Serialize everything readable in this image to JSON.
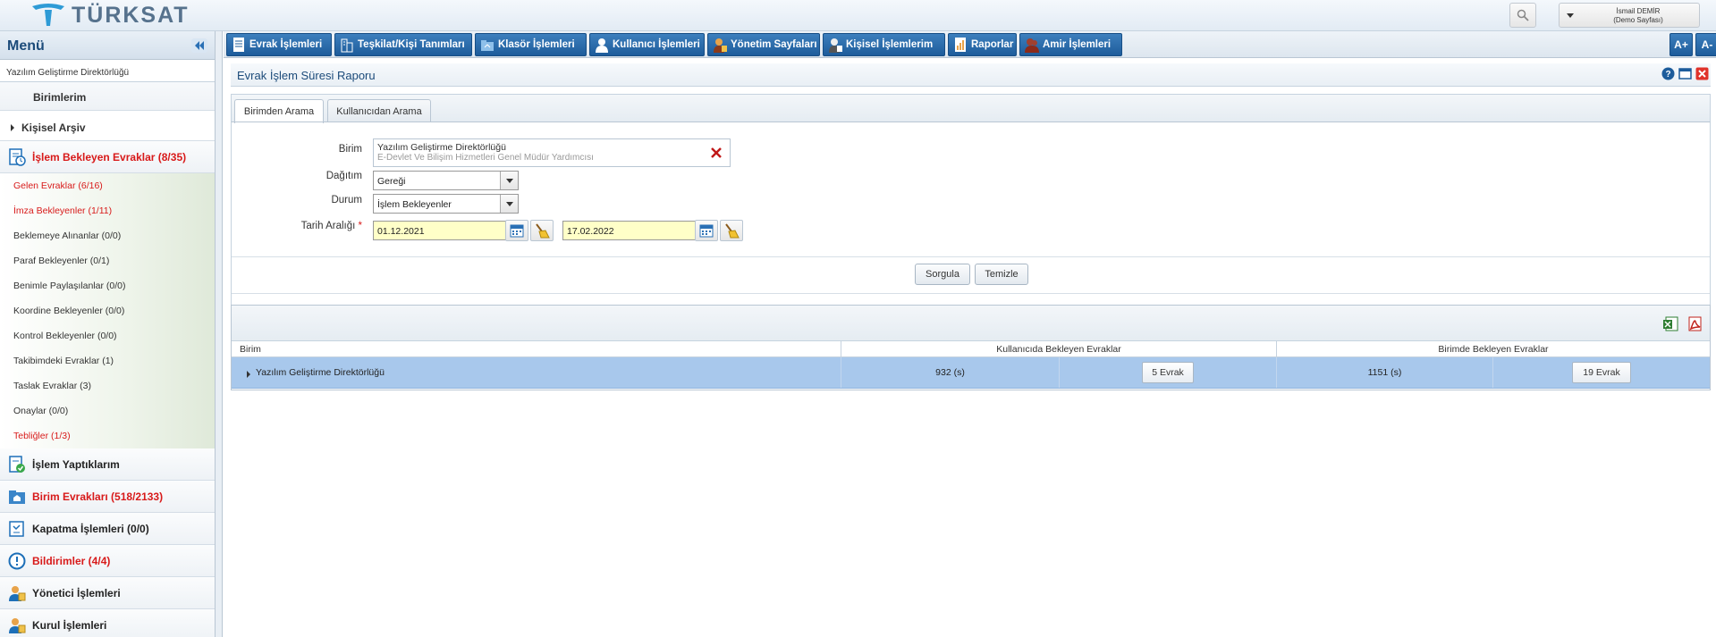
{
  "header": {
    "logo_text": "TÜRKSAT",
    "user": {
      "name": "İsmail DEMİR",
      "role": "(Demo Sayfası)"
    }
  },
  "sidebar": {
    "title": "Menü",
    "department": "Yazılım Geliştirme Direktörlüğü",
    "birimlerim": "Birimlerim",
    "kisisel_arsiv": "Kişisel Arşiv",
    "pending_group": "İşlem Bekleyen Evraklar (8/35)",
    "pending_items": [
      {
        "label": "Gelen Evraklar (6/16)",
        "highlight": true
      },
      {
        "label": "İmza Bekleyenler (1/11)",
        "highlight": true
      },
      {
        "label": "Beklemeye Alınanlar (0/0)",
        "highlight": false
      },
      {
        "label": "Paraf Bekleyenler (0/1)",
        "highlight": false
      },
      {
        "label": "Benimle Paylaşılanlar (0/0)",
        "highlight": false
      },
      {
        "label": "Koordine Bekleyenler (0/0)",
        "highlight": false
      },
      {
        "label": "Kontrol Bekleyenler (0/0)",
        "highlight": false
      },
      {
        "label": "Takibimdeki Evraklar (1)",
        "highlight": false
      },
      {
        "label": "Taslak Evraklar (3)",
        "highlight": false
      },
      {
        "label": "Onaylar (0/0)",
        "highlight": false
      },
      {
        "label": "Tebliğler (1/3)",
        "highlight": true
      }
    ],
    "groups": [
      {
        "label": "İşlem Yaptıklarım",
        "highlight": false,
        "icon": "done-doc-icon"
      },
      {
        "label": "Birim Evrakları (518/2133)",
        "highlight": true,
        "icon": "unit-folder-icon"
      },
      {
        "label": "Kapatma İşlemleri (0/0)",
        "highlight": false,
        "icon": "close-doc-icon"
      },
      {
        "label": "Bildirimler (4/4)",
        "highlight": true,
        "icon": "alert-icon"
      },
      {
        "label": "Yönetici İşlemleri",
        "highlight": false,
        "icon": "manager-icon"
      },
      {
        "label": "Kurul İşlemleri",
        "highlight": false,
        "icon": "board-icon"
      }
    ]
  },
  "nav": {
    "items": [
      "Evrak İşlemleri",
      "Teşkilat/Kişi Tanımları",
      "Klasör İşlemleri",
      "Kullanıcı İşlemleri",
      "Yönetim Sayfaları",
      "Kişisel İşlemlerim",
      "Raporlar",
      "Amir İşlemleri"
    ],
    "font_increase": "A+",
    "font_decrease": "A-"
  },
  "panel": {
    "title": "Evrak İşlem Süresi Raporu",
    "tabs": [
      "Birimden Arama",
      "Kullanıcıdan Arama"
    ],
    "active_tab": 0
  },
  "form": {
    "birim_label": "Birim",
    "birim_value": "Yazılım Geliştirme Direktörlüğü",
    "birim_sub": "E-Devlet Ve Bilişim Hizmetleri Genel Müdür Yardımcısı",
    "dagitim_label": "Dağıtım",
    "dagitim_value": "Gereği",
    "durum_label": "Durum",
    "durum_value": "İşlem Bekleyenler",
    "tarih_label": "Tarih Aralığı",
    "required_mark": "*",
    "date_start": "01.12.2021",
    "date_end": "17.02.2022",
    "query_button": "Sorgula",
    "clear_button": "Temizle"
  },
  "table": {
    "columns": [
      "Birim",
      "Kullanıcıda Bekleyen Evraklar",
      "Birimde Bekleyen Evraklar"
    ],
    "rows": [
      {
        "birim": "Yazılım Geliştirme Direktörlüğü",
        "user_time": "932 (s)",
        "user_docs": "5 Evrak",
        "unit_time": "1151 (s)",
        "unit_docs": "19 Evrak"
      }
    ]
  },
  "colors": {
    "nav_blue": "#1d5c9b",
    "alert_red": "#d81a1a",
    "row_selected": "#a8c8ec",
    "date_bg": "#ffffc8"
  }
}
